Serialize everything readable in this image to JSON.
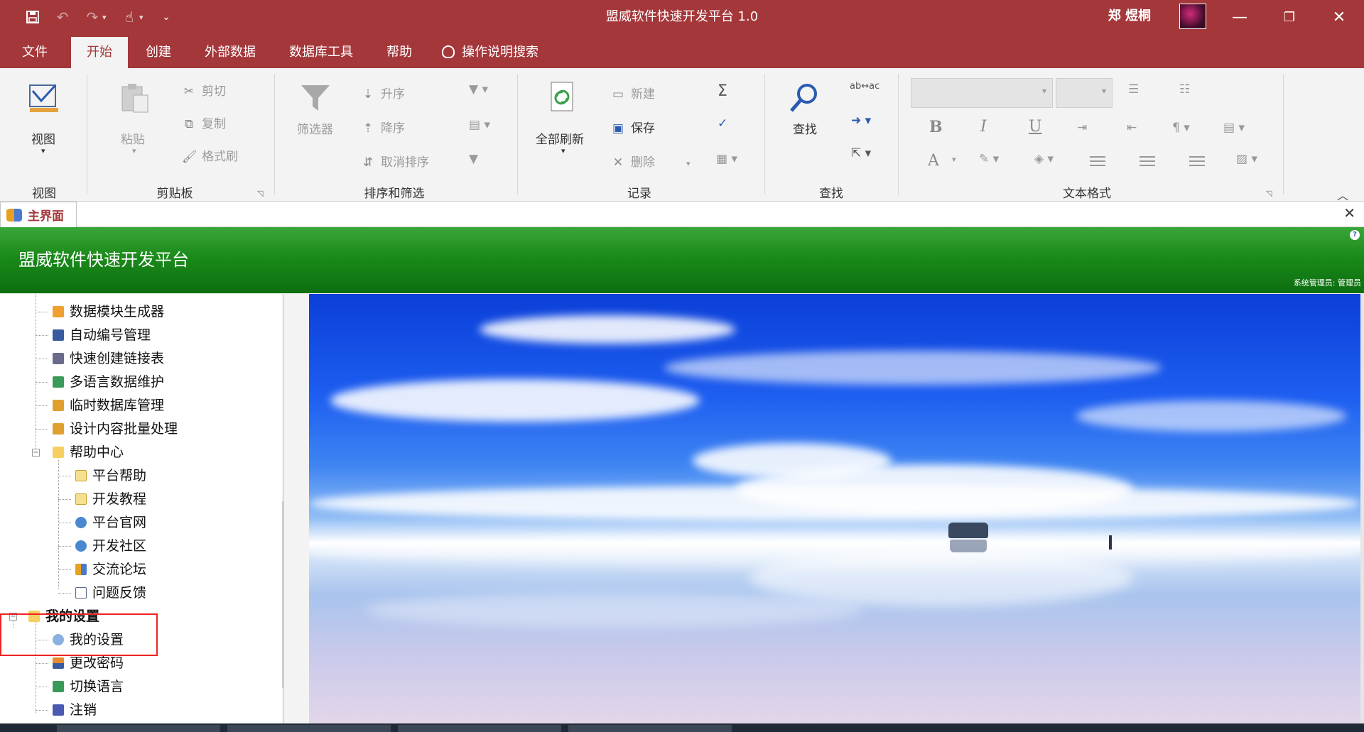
{
  "window": {
    "title": "盟威软件快速开发平台 1.0",
    "user_name": "郑 煜桐",
    "controls": [
      "minimize",
      "restore",
      "close"
    ]
  },
  "quick_access": {
    "icons": [
      "save-icon",
      "undo-icon",
      "redo-icon",
      "touch-mode-icon",
      "customize-icon"
    ]
  },
  "menu": {
    "tabs": [
      {
        "label": "文件",
        "active": false
      },
      {
        "label": "开始",
        "active": true
      },
      {
        "label": "创建",
        "active": false
      },
      {
        "label": "外部数据",
        "active": false
      },
      {
        "label": "数据库工具",
        "active": false
      },
      {
        "label": "帮助",
        "active": false
      }
    ],
    "search_label": "操作说明搜索"
  },
  "ribbon": {
    "view": {
      "button": "视图",
      "group": "视图"
    },
    "clipboard": {
      "paste": "粘贴",
      "cut": "剪切",
      "copy": "复制",
      "format_painter": "格式刷",
      "group": "剪贴板"
    },
    "sort_filter": {
      "filter": "筛选器",
      "ascending": "升序",
      "descending": "降序",
      "remove_sort": "取消排序",
      "group": "排序和筛选"
    },
    "records": {
      "refresh_all": "全部刷新",
      "new": "新建",
      "save": "保存",
      "delete": "删除",
      "group": "记录"
    },
    "find": {
      "find": "查找",
      "group": "查找"
    },
    "text_format": {
      "bold": "B",
      "italic": "I",
      "underline": "U",
      "font_color": "A",
      "group": "文本格式"
    }
  },
  "document_tab": {
    "label": "主界面"
  },
  "banner": {
    "title": "盟威软件快速开发平台",
    "user_info": "系统管理员: 管理员"
  },
  "tree": {
    "items": [
      {
        "label": "数据模块生成器",
        "level": 2,
        "icon": "wand-icon"
      },
      {
        "label": "自动编号管理",
        "level": 2,
        "icon": "list-icon"
      },
      {
        "label": "快速创建链接表",
        "level": 2,
        "icon": "link-icon"
      },
      {
        "label": "多语言数据维护",
        "level": 2,
        "icon": "chart-icon"
      },
      {
        "label": "临时数据库管理",
        "level": 2,
        "icon": "note-icon"
      },
      {
        "label": "设计内容批量处理",
        "level": 2,
        "icon": "note-icon"
      },
      {
        "label": "帮助中心",
        "level": 2,
        "icon": "folder-icon",
        "expandable": true
      },
      {
        "label": "平台帮助",
        "level": 3,
        "icon": "help-icon"
      },
      {
        "label": "开发教程",
        "level": 3,
        "icon": "help-icon"
      },
      {
        "label": "平台官网",
        "level": 3,
        "icon": "globe-icon"
      },
      {
        "label": "开发社区",
        "level": 3,
        "icon": "globe-icon"
      },
      {
        "label": "交流论坛",
        "level": 3,
        "icon": "users-icon"
      },
      {
        "label": "问题反馈",
        "level": 3,
        "icon": "edit-icon"
      },
      {
        "label": "我的设置",
        "level": 1,
        "icon": "folder-icon",
        "expandable": true,
        "bold": true
      },
      {
        "label": "我的设置",
        "level": 2,
        "icon": "settings-icon"
      },
      {
        "label": "更改密码",
        "level": 2,
        "icon": "user-key-icon"
      },
      {
        "label": "切换语言",
        "level": 2,
        "icon": "chart-icon"
      },
      {
        "label": "注销",
        "level": 2,
        "icon": "logout-icon"
      }
    ]
  },
  "colors": {
    "title_bar": "#a4373a",
    "banner_green": "#1a8a1a",
    "highlight_box": "#ee2222"
  }
}
